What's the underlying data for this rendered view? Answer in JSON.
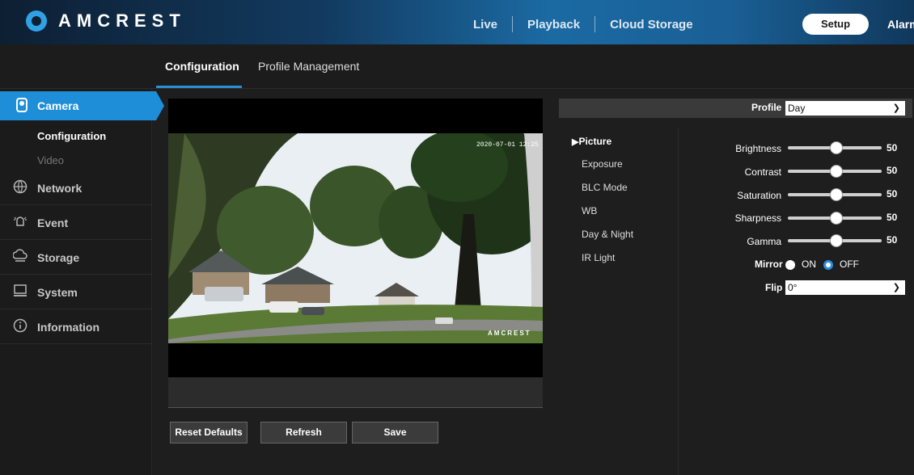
{
  "brand": {
    "name": "AMCREST"
  },
  "topnav": {
    "live": "Live",
    "playback": "Playback",
    "cloud": "Cloud Storage",
    "setup": "Setup",
    "alarm": "Alarm"
  },
  "tabs": {
    "configuration": "Configuration",
    "profile_management": "Profile Management"
  },
  "sidebar": {
    "camera": "Camera",
    "sub_configuration": "Configuration",
    "sub_video": "Video",
    "items": [
      {
        "label": "Network",
        "icon": "network-icon"
      },
      {
        "label": "Event",
        "icon": "event-icon"
      },
      {
        "label": "Storage",
        "icon": "storage-icon"
      },
      {
        "label": "System",
        "icon": "system-icon"
      },
      {
        "label": "Information",
        "icon": "information-icon"
      }
    ]
  },
  "video": {
    "timestamp": "2020-07-01 12:25",
    "watermark": "AMCREST"
  },
  "buttons": {
    "reset": "Reset Defaults",
    "refresh": "Refresh",
    "save": "Save"
  },
  "profile": {
    "label": "Profile",
    "value": "Day"
  },
  "menu": {
    "picture": "Picture",
    "exposure": "Exposure",
    "blc": "BLC Mode",
    "wb": "WB",
    "daynight": "Day & Night",
    "ir": "IR Light"
  },
  "settings": {
    "brightness": {
      "label": "Brightness",
      "value": "50"
    },
    "contrast": {
      "label": "Contrast",
      "value": "50"
    },
    "saturation": {
      "label": "Saturation",
      "value": "50"
    },
    "sharpness": {
      "label": "Sharpness",
      "value": "50"
    },
    "gamma": {
      "label": "Gamma",
      "value": "50"
    },
    "mirror": {
      "label": "Mirror",
      "on": "ON",
      "off": "OFF",
      "selected": "OFF"
    },
    "flip": {
      "label": "Flip",
      "value": "0°"
    }
  },
  "colors": {
    "accent": "#1e8ed8",
    "bg": "#1e1e1e"
  }
}
